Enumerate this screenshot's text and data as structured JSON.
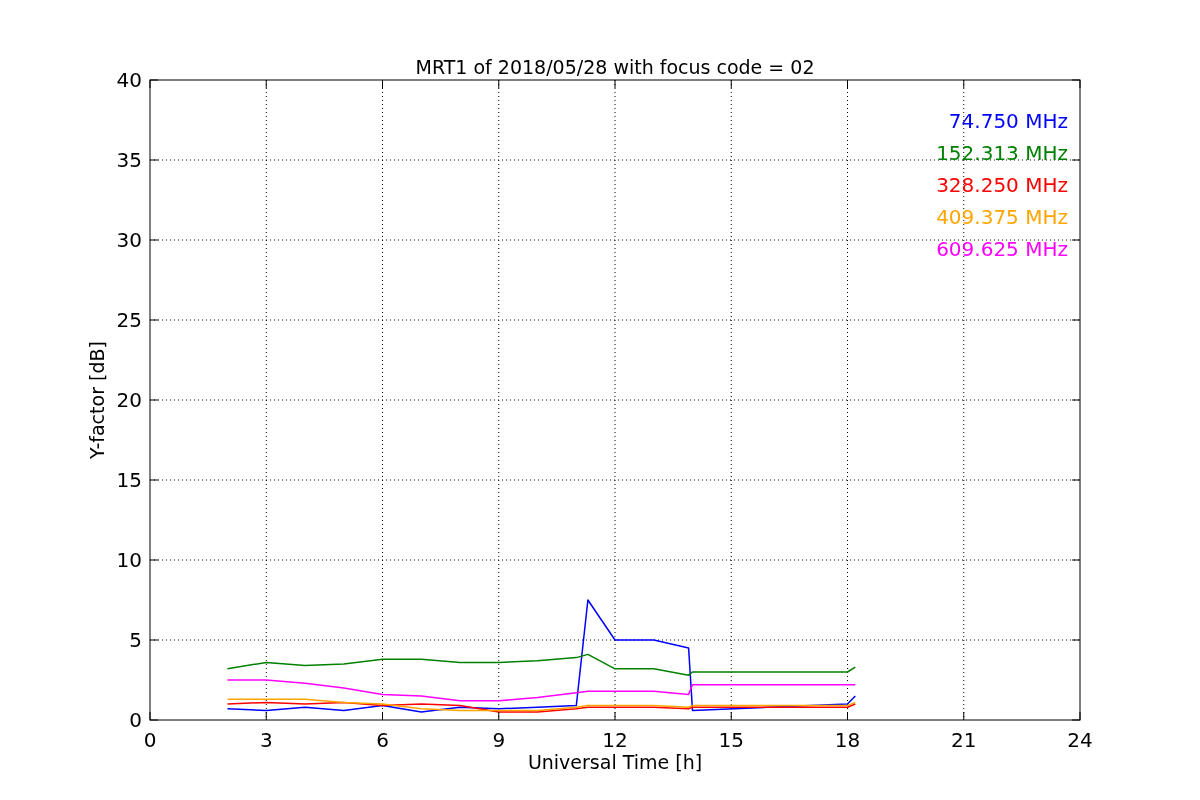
{
  "figure": {
    "chart_data": {
      "type": "line",
      "title": "MRT1 of 2018/05/28 with focus code = 02",
      "xlabel": "Universal Time [h]",
      "ylabel": "Y-factor [dB]",
      "x": [
        2,
        3,
        4,
        5,
        6,
        7,
        8,
        9,
        10,
        11,
        11.3,
        12,
        13,
        13.9,
        14,
        18,
        18.2
      ],
      "series": [
        {
          "name": "74.750 MHz",
          "color": "#0000ff",
          "values": [
            0.7,
            0.6,
            0.8,
            0.6,
            0.9,
            0.5,
            0.8,
            0.7,
            0.8,
            0.9,
            7.5,
            5.0,
            5.0,
            4.5,
            0.6,
            1.0,
            1.5
          ]
        },
        {
          "name": "152.313 MHz",
          "color": "#008000",
          "values": [
            3.2,
            3.6,
            3.4,
            3.5,
            3.8,
            3.8,
            3.6,
            3.6,
            3.7,
            3.9,
            4.1,
            3.2,
            3.2,
            2.8,
            3.0,
            3.0,
            3.3
          ]
        },
        {
          "name": "328.250 MHz",
          "color": "#ff0000",
          "values": [
            1.0,
            1.1,
            1.0,
            1.1,
            0.9,
            1.0,
            0.9,
            0.5,
            0.5,
            0.7,
            0.8,
            0.8,
            0.8,
            0.7,
            0.8,
            0.8,
            1.0
          ]
        },
        {
          "name": "409.375 MHz",
          "color": "#ffa500",
          "values": [
            1.3,
            1.3,
            1.3,
            1.1,
            1.0,
            0.7,
            0.6,
            0.6,
            0.6,
            0.8,
            0.9,
            0.9,
            0.9,
            0.8,
            0.9,
            0.9,
            1.1
          ]
        },
        {
          "name": "609.625 MHz",
          "color": "#ff00ff",
          "values": [
            2.5,
            2.5,
            2.3,
            2.0,
            1.6,
            1.5,
            1.2,
            1.2,
            1.4,
            1.7,
            1.8,
            1.8,
            1.8,
            1.6,
            2.2,
            2.2,
            2.2
          ]
        }
      ],
      "xlim": [
        0,
        24
      ],
      "ylim": [
        0,
        40
      ],
      "xticks": [
        0,
        3,
        6,
        9,
        12,
        15,
        18,
        21,
        24
      ],
      "yticks": [
        0,
        5,
        10,
        15,
        20,
        25,
        30,
        35,
        40
      ],
      "grid": true
    }
  }
}
